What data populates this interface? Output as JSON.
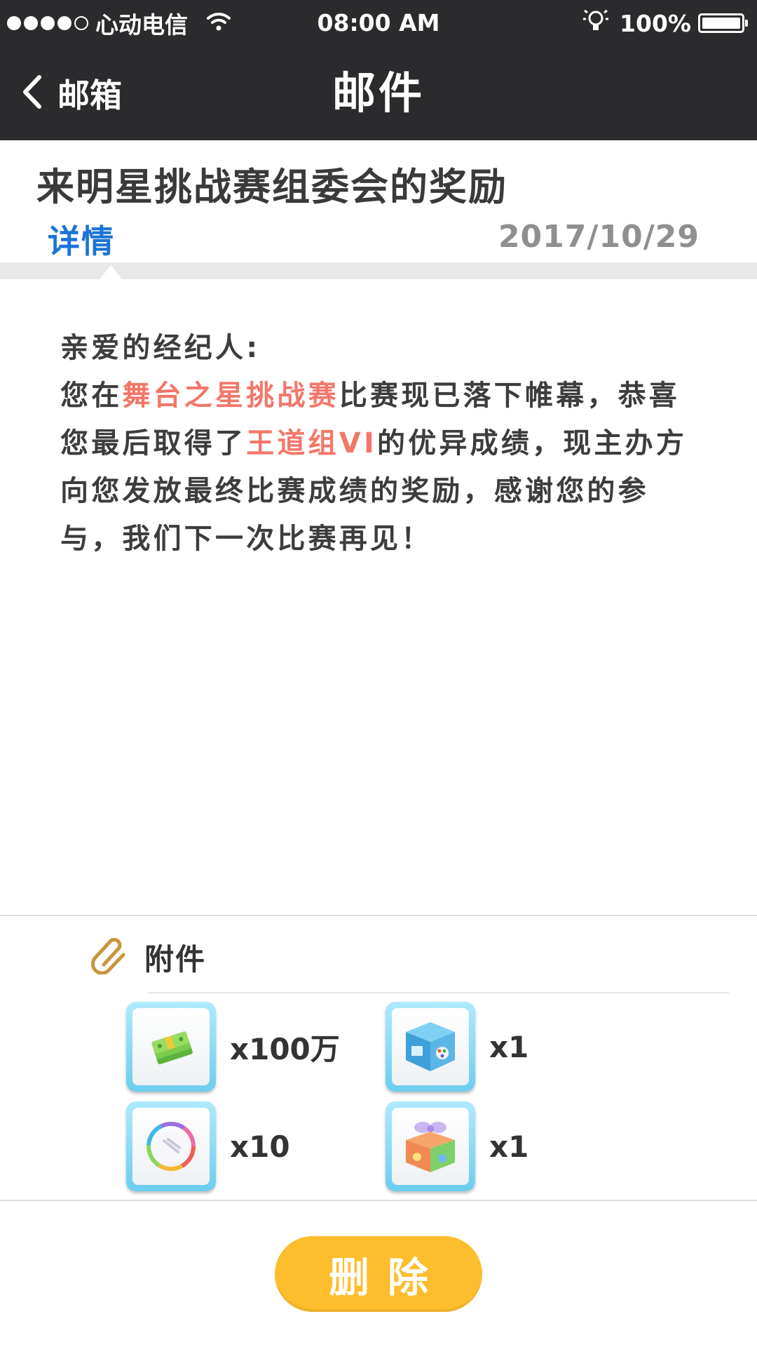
{
  "status_bar": {
    "carrier": "心动电信",
    "time": "08:00 AM",
    "battery": "100%"
  },
  "nav": {
    "back_label": "邮箱",
    "title": "邮件"
  },
  "mail": {
    "title": "来明星挑战赛组委会的奖励",
    "tab_label": "详情",
    "date": "2017/10/29",
    "greeting": "亲爱的经纪人:",
    "body": {
      "t1": "您在",
      "hl1": "舞台之星挑战赛",
      "t2": "比赛现已落下帷幕，恭喜您最后取得了",
      "hl2": "王道组VI",
      "t3": "的优异成绩，现主办方向您发放最终比赛成绩的奖励，感谢您的参与，我们下一次比赛再见！"
    },
    "highlight_color": "#f2776a"
  },
  "attachments": {
    "label": "附件",
    "items": [
      {
        "icon": "cash-icon",
        "qty": "x100万"
      },
      {
        "icon": "blue-box-icon",
        "qty": "x1"
      },
      {
        "icon": "rainbow-gem-icon",
        "qty": "x10"
      },
      {
        "icon": "gift-box-icon",
        "qty": "x1"
      }
    ]
  },
  "actions": {
    "delete_label": "删除"
  },
  "colors": {
    "header_bg": "#2b2b2d",
    "tab_blue": "#1b73d8",
    "button_yellow": "#fdbd2c"
  }
}
